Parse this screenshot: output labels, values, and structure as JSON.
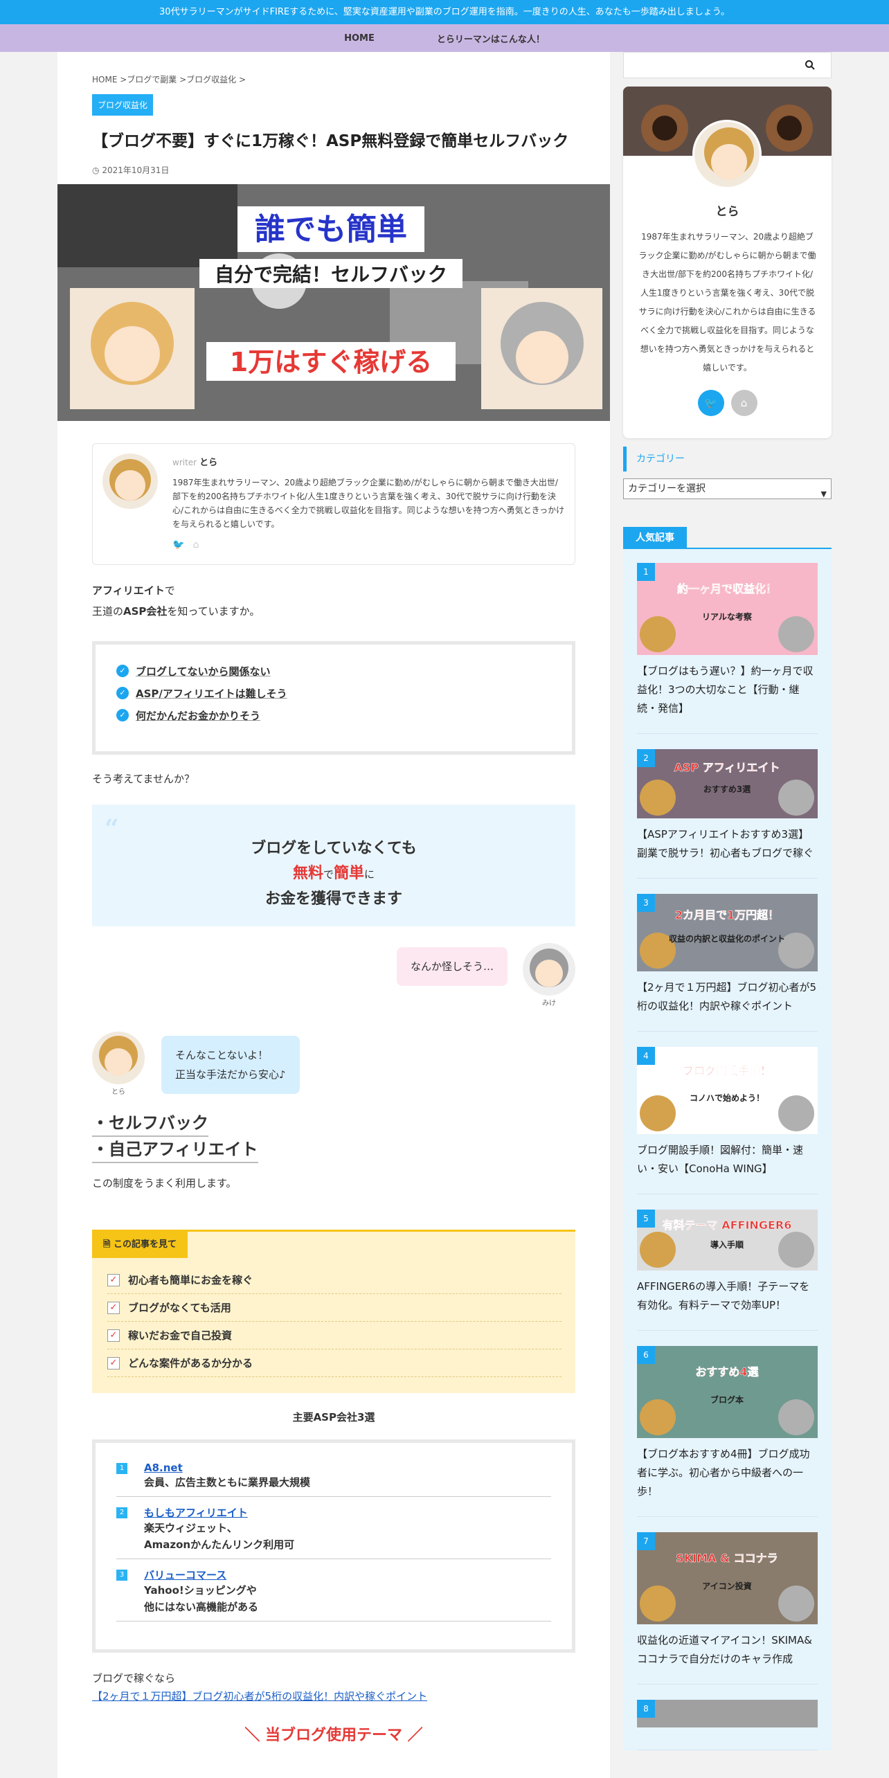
{
  "topbar": {
    "text": "30代サラリーマンがサイドFIREするために、堅実な資産運用や副業のブログ運用を指南。一度きりの人生、あなたも一歩踏み出しましょう。"
  },
  "nav": {
    "items": [
      "HOME",
      "とらリーマンはこんな人！"
    ]
  },
  "breadcrumb": "HOME >ブログで副業 >ブログ収益化 >",
  "category_badge": "ブログ収益化",
  "article": {
    "title": "【ブログ不要】すぐに1万稼ぐ！ASP無料登録で簡単セルフバック",
    "date": "2021年10月31日",
    "eyecatch": {
      "line1": "誰でも簡単",
      "line2": "自分で完結！セルフバック",
      "line3": "1万はすぐ稼げる"
    }
  },
  "author": {
    "writer_label": "writer",
    "name": "とら",
    "bio": "1987年生まれサラリーマン、20歳より超絶ブラック企業に勤め/がむしゃらに朝から朝まで働き大出世/部下を約200名持ちプチホワイト化/人生1度きりという言葉を強く考え、30代で脱サラに向け行動を決心/これからは自由に生きるべく全力で挑戦し収益化を目指す。同じような想いを持つ方へ勇気ときっかけを与えられると嬉しいです。"
  },
  "intro": {
    "line1_bold": "アフィリエイト",
    "line1_rest": "で",
    "line2_pre": "王道の",
    "line2_bold": "ASP会社",
    "line2_post": "を知っていますか。"
  },
  "checklist": [
    "ブログしてないから関係ない",
    "ASP/アフィリエイトは難しそう",
    "何だかんだお金かかりそう"
  ],
  "question": "そう考えてませんか？",
  "quote": {
    "l1": "ブログをしていなくても",
    "free": "無料",
    "de": "で",
    "easy": "簡単",
    "ni": "に",
    "l3": "お金を獲得できます"
  },
  "chat1": {
    "text": "なんか怪しそう…",
    "name": "みけ"
  },
  "chat2": {
    "l1": "そんなことないよ！",
    "l2": "正当な手法だから安心♪",
    "name": "とら"
  },
  "headings": [
    "・セルフバック",
    "・自己アフィリエイト"
  ],
  "use_text": "この制度をうまく利用します。",
  "memo": {
    "tag": "この記事を見て",
    "items": [
      "初心者も簡単にお金を稼ぐ",
      "ブログがなくても活用",
      "稼いだお金で自己投資",
      "どんな案件があるか分かる"
    ]
  },
  "asp": {
    "title": "主要ASP会社3選",
    "items": [
      {
        "num": "1",
        "name": "A8.net",
        "desc1": "会員、広告主数ともに業界最大規模",
        "desc2": ""
      },
      {
        "num": "2",
        "name": "もしもアフィリエイト",
        "desc1": "楽天ウィジェット、",
        "desc2": "Amazonかんたんリンク利用可"
      },
      {
        "num": "3",
        "name": "バリューコマース",
        "desc1": "Yahoo!ショッピングや",
        "desc2": "他にはない高機能がある"
      }
    ]
  },
  "footer_link": {
    "label": "ブログで稼ぐなら",
    "link": "【2ヶ月で１万円超】ブログ初心者が5桁の収益化！内訳や稼ぐポイント"
  },
  "theme_heading": "当ブログ使用テーマ",
  "sidebar": {
    "profile": {
      "name": "とら",
      "bio": "1987年生まれサラリーマン、20歳より超絶ブラック企業に勤め/がむしゃらに朝から朝まで働き大出世/部下を約200名持ちプチホワイト化/人生1度きりという言葉を強く考え、30代で脱サラに向け行動を決心/これからは自由に生きるべく全力で挑戦し収益化を目指す。同じような想いを持つ方へ勇気ときっかけを与えられると嬉しいです。"
    },
    "category_title": "カテゴリー",
    "category_select": "カテゴリーを選択",
    "popular_title": "人気記事",
    "popular": [
      {
        "num": "1",
        "thumb": "約一ヶ月で収益化！",
        "thumb2": "リアルな考察",
        "title": "【ブログはもう遅い？】約一ヶ月で収益化！3つの大切なこと【行動・継続・発信】",
        "bg": "#f7b7c8"
      },
      {
        "num": "2",
        "thumb": "ASP アフィリエイト",
        "thumb2": "おすすめ3選",
        "title": "【ASPアフィリエイトおすすめ3選】副業で脱サラ！初心者もブログで稼ぐ",
        "bg": "#7d6b7a"
      },
      {
        "num": "3",
        "thumb": "2カ月目で1万円超！",
        "thumb2": "収益の内訳と収益化のポイント",
        "title": "【2ヶ月で１万円超】ブログ初心者が5桁の収益化！内訳や稼ぐポイント",
        "bg": "#8a8f97"
      },
      {
        "num": "4",
        "thumb": "ブログ開設手順！",
        "thumb2": "コノハで始めよう！",
        "title": "ブログ開設手順！図解付：簡単・速い・安い【ConoHa WING】",
        "bg": "#ffffff"
      },
      {
        "num": "5",
        "thumb": "有料テーマ AFFINGER6",
        "thumb2": "導入手順",
        "title": "AFFINGER6の導入手順！子テーマを有効化。有料テーマで効率UP！",
        "bg": "#dcdcdc"
      },
      {
        "num": "6",
        "thumb": "おすすめ4選",
        "thumb2": "ブログ本",
        "title": "【ブログ本おすすめ4冊】ブログ成功者に学ぶ。初心者から中級者への一歩！",
        "bg": "#6f9a8f"
      },
      {
        "num": "7",
        "thumb": "SKIMA & ココナラ",
        "thumb2": "アイコン投資",
        "title": "収益化の近道マイアイコン！SKIMA&ココナラで自分だけのキャラ作成",
        "bg": "#8a7c6c"
      },
      {
        "num": "8",
        "thumb": "",
        "thumb2": "",
        "title": "",
        "bg": "#a0a0a0"
      }
    ]
  }
}
